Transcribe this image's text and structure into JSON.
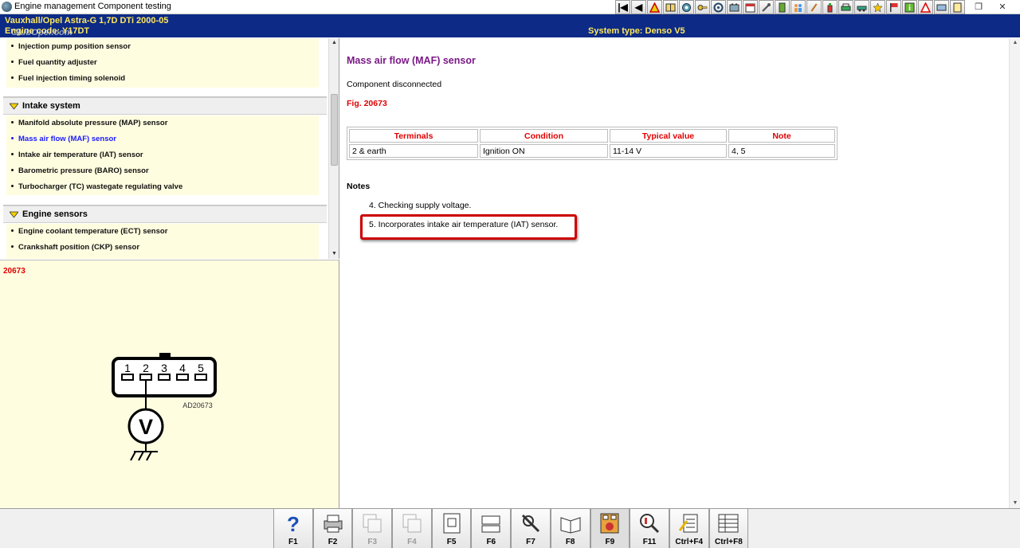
{
  "window": {
    "title": "Engine management Component testing"
  },
  "toolbar": {
    "icons": [
      "first-icon",
      "previous-icon",
      "warning-icon",
      "book-icon",
      "gear-icon",
      "key-icon",
      "wheel-icon",
      "battery-icon",
      "calendar-icon",
      "wrench-icon",
      "door-icon",
      "people-icon",
      "tool-icon",
      "bottle-icon",
      "print-icon",
      "car-icon",
      "star-icon",
      "flag-icon",
      "info-icon",
      "hazard-icon",
      "aircon-icon",
      "exit-icon"
    ],
    "first_label": "|◀",
    "prev_label": "◀",
    "restore_label": "❐",
    "close_label": "✕"
  },
  "header": {
    "vehicle": "Vauxhall/Opel   Astra-G   1,7D DTi 2000-05",
    "engine": "Engine code: Y17DT",
    "system_type": "System type: Denso V5",
    "watermark": "ClubOpel.com"
  },
  "nav": {
    "groups": [
      {
        "title": "",
        "items": [
          {
            "label": "Injection pump position sensor",
            "active": false
          },
          {
            "label": "Fuel quantity adjuster",
            "active": false
          },
          {
            "label": "Fuel injection timing solenoid",
            "active": false
          }
        ]
      },
      {
        "title": "Intake system",
        "items": [
          {
            "label": "Manifold absolute pressure (MAP) sensor",
            "active": false
          },
          {
            "label": "Mass air flow (MAF) sensor",
            "active": true
          },
          {
            "label": "Intake air temperature (IAT) sensor",
            "active": false
          },
          {
            "label": "Barometric pressure (BARO) sensor",
            "active": false
          },
          {
            "label": "Turbocharger (TC) wastegate regulating valve",
            "active": false
          }
        ]
      },
      {
        "title": "Engine sensors",
        "items": [
          {
            "label": "Engine coolant temperature (ECT) sensor",
            "active": false
          },
          {
            "label": "Crankshaft position (CKP) sensor",
            "active": false
          }
        ]
      }
    ]
  },
  "figure": {
    "id": "20673",
    "code": "AD20673",
    "pins": [
      "1",
      "2",
      "3",
      "4",
      "5"
    ],
    "meter_symbol": "V"
  },
  "content": {
    "title": "Mass air flow (MAF) sensor",
    "state": "Component disconnected",
    "fig_ref": "Fig. 20673",
    "table": {
      "headers": [
        "Terminals",
        "Condition",
        "Typical value",
        "Note"
      ],
      "rows": [
        [
          "2 & earth",
          "Ignition ON",
          "11-14 V",
          "4, 5"
        ]
      ]
    },
    "notes_title": "Notes",
    "notes": [
      "4. Checking supply voltage.",
      "5. Incorporates intake air temperature (IAT) sensor."
    ]
  },
  "fkeys": [
    {
      "label": "F1",
      "icon": "help-icon",
      "enabled": true
    },
    {
      "label": "F2",
      "icon": "printer-icon",
      "enabled": true
    },
    {
      "label": "F3",
      "icon": "copy-icon",
      "enabled": false
    },
    {
      "label": "F4",
      "icon": "copy-alt-icon",
      "enabled": false
    },
    {
      "label": "F5",
      "icon": "component-icon",
      "enabled": true
    },
    {
      "label": "F6",
      "icon": "connector-icon",
      "enabled": true
    },
    {
      "label": "F7",
      "icon": "tools-icon",
      "enabled": true
    },
    {
      "label": "F8",
      "icon": "manual-icon",
      "enabled": true
    },
    {
      "label": "F9",
      "icon": "pinout-icon",
      "enabled": true,
      "pressed": true
    },
    {
      "label": "F11",
      "icon": "search-icon",
      "enabled": true
    },
    {
      "label": "Ctrl+F4",
      "icon": "notes-icon",
      "enabled": true
    },
    {
      "label": "Ctrl+F8",
      "icon": "table-icon",
      "enabled": true
    }
  ],
  "colors": {
    "header_bg": "#0c2a86",
    "header_text": "#ffe75c",
    "title_purple": "#7a1a86",
    "red": "#e00000",
    "active_link": "#1a1aff",
    "panel_yellow": "#fffde0"
  }
}
